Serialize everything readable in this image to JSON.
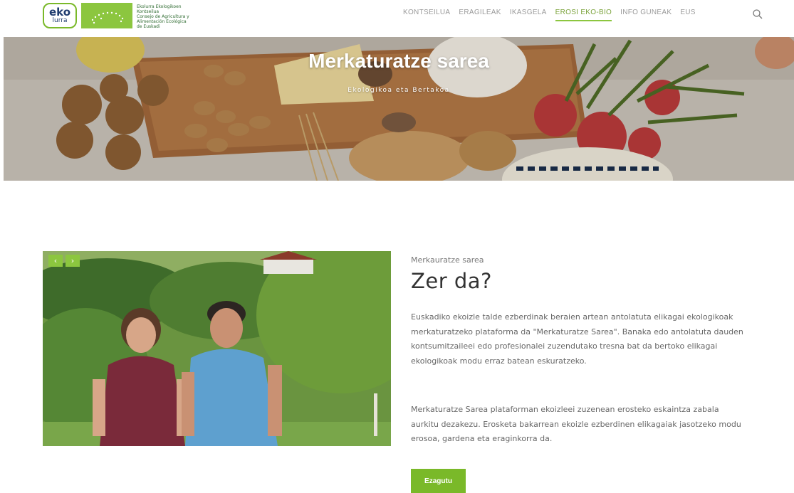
{
  "header": {
    "logo_line1": "eko",
    "logo_line2": "lurra",
    "council_text": [
      "Ekolurra Ekologikoen",
      "Kontseilua",
      "Consejo de Agricultura y",
      "Alimentación Ecológica",
      "de Euskadi"
    ]
  },
  "nav": {
    "items": [
      "KONTSEILUA",
      "ERAGILEAK",
      "IKASGELA",
      "EROSI EKO-BIO",
      "INFO GUNEAK",
      "EUS"
    ],
    "active_index": 3
  },
  "icons": {
    "search": "search-icon",
    "prev": "chevron-left-icon",
    "next": "chevron-right-icon"
  },
  "hero": {
    "title": "Merkaturatze sarea",
    "subtitle": "Ekologikoa eta Bertakoa"
  },
  "section": {
    "kicker": "Merkauratze sarea",
    "title": "Zer da?",
    "p1": "Euskadiko ekoizle talde ezberdinak beraien artean antolatuta elikagai ekologikoak merkaturatzeko plataforma da \"Merkaturatze Sarea\". Banaka edo antolatuta dauden kontsumitzaileei edo profesionalei zuzendutako tresna bat da bertoko elikagai ekologikoak modu erraz batean eskuratzeko.",
    "p2": "Merkaturatze Sarea plataforman ekoizleei zuzenean erosteko eskaintza zabala aurkitu dezakezu. Erosketa bakarrean ekoizle ezberdinen elikagaiak jasotzeko modu erosoa, gardena eta eraginkorra da.",
    "cta": "Ezagutu"
  },
  "slider": {
    "prev_label": "‹",
    "next_label": "›"
  },
  "colors": {
    "accent": "#8cc63f",
    "button": "#7ab929",
    "logo_blue": "#1f3b6e"
  }
}
